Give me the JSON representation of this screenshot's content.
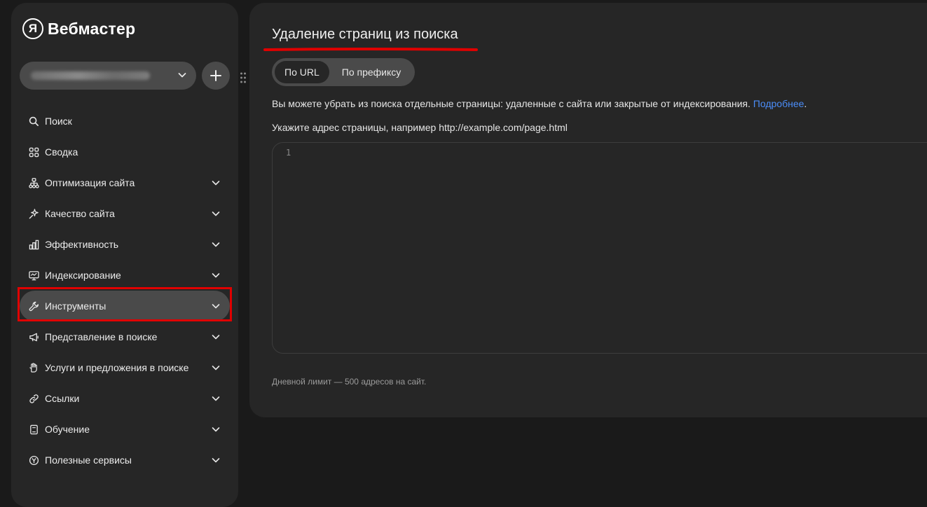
{
  "app": {
    "logo_letter": "Я",
    "logo_text": "Вебмастер"
  },
  "sidebar": {
    "items": [
      {
        "label": "Поиск",
        "icon": "search-icon",
        "has_chevron": false
      },
      {
        "label": "Сводка",
        "icon": "dashboard-icon",
        "has_chevron": false
      },
      {
        "label": "Оптимизация сайта",
        "icon": "sitemap-icon",
        "has_chevron": true
      },
      {
        "label": "Качество сайта",
        "icon": "sparkle-icon",
        "has_chevron": true
      },
      {
        "label": "Эффективность",
        "icon": "bar-chart-icon",
        "has_chevron": true
      },
      {
        "label": "Индексирование",
        "icon": "monitor-icon",
        "has_chevron": true
      },
      {
        "label": "Инструменты",
        "icon": "wrench-icon",
        "has_chevron": true,
        "active": true
      },
      {
        "label": "Представление в поиске",
        "icon": "megaphone-icon",
        "has_chevron": true
      },
      {
        "label": "Услуги и предложения в поиске",
        "icon": "hand-icon",
        "has_chevron": true
      },
      {
        "label": "Ссылки",
        "icon": "link-icon",
        "has_chevron": true
      },
      {
        "label": "Обучение",
        "icon": "book-icon",
        "has_chevron": true
      },
      {
        "label": "Полезные сервисы",
        "icon": "services-icon",
        "has_chevron": true
      }
    ]
  },
  "main": {
    "title": "Удаление страниц из поиска",
    "tabs": [
      {
        "label": "По URL",
        "active": true
      },
      {
        "label": "По префиксу",
        "active": false
      }
    ],
    "description": "Вы можете убрать из поиска отдельные страницы: удаленные с сайта или закрытые от индексирования.",
    "more_link": "Подробнее",
    "more_suffix": ".",
    "hint": "Укажите адрес страницы, например http://example.com/page.html",
    "editor": {
      "line_number": "1",
      "value": ""
    },
    "limit_note": "Дневной лимит — 500 адресов на сайт."
  },
  "colors": {
    "background": "#1a1a1a",
    "panel": "#262626",
    "control": "#4a4a4a",
    "link": "#4b8df8",
    "highlight": "#e00000"
  }
}
